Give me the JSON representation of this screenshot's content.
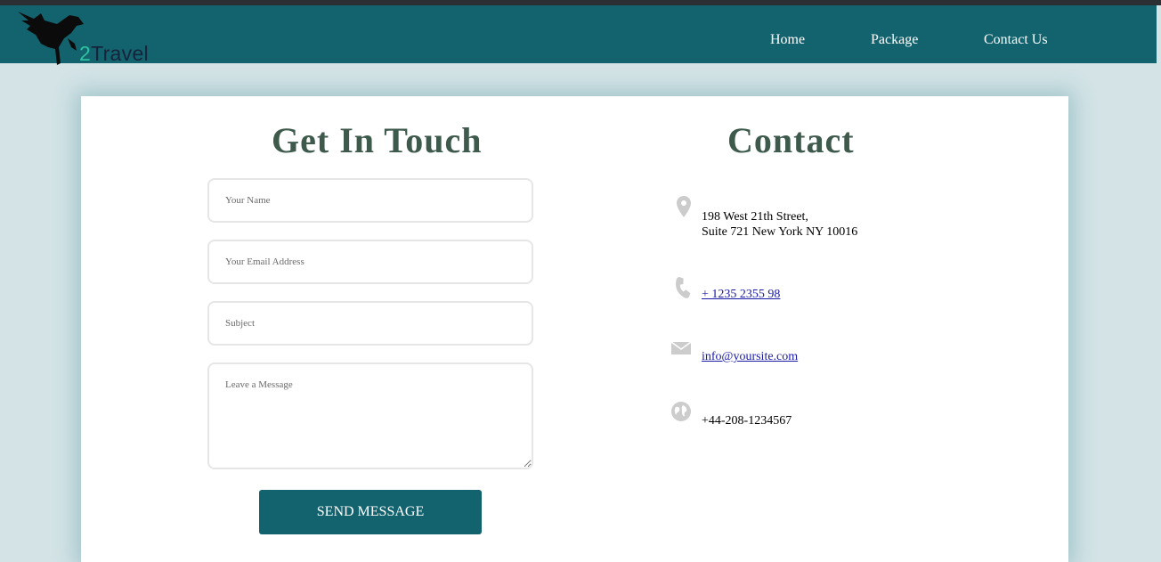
{
  "brand": {
    "logo_icon": "bird-icon",
    "logo_number": "2",
    "logo_word": "Travel"
  },
  "nav": {
    "items": [
      {
        "label": "Home"
      },
      {
        "label": "Package"
      },
      {
        "label": "Contact Us"
      }
    ]
  },
  "form": {
    "title": "Get In Touch",
    "name_placeholder": "Your Name",
    "email_placeholder": "Your Email Address",
    "subject_placeholder": "Subject",
    "message_placeholder": "Leave a Message",
    "submit_label": "SEND MESSAGE"
  },
  "contact": {
    "title": "Contact",
    "address_line1": "198 West 21th Street,",
    "address_line2": "Suite 721 New York NY 10016",
    "phone": "+ 1235 2355 98",
    "email": "info@yoursite.com",
    "website": "+44-208-1234567",
    "icons": [
      "map-pin-icon",
      "phone-icon",
      "envelope-icon",
      "globe-icon"
    ]
  },
  "colors": {
    "primary": "#13636f",
    "page_background": "#d3e3e6",
    "heading": "#3e5a4c",
    "icon": "#cccccc",
    "link": "#1a1aa6"
  }
}
